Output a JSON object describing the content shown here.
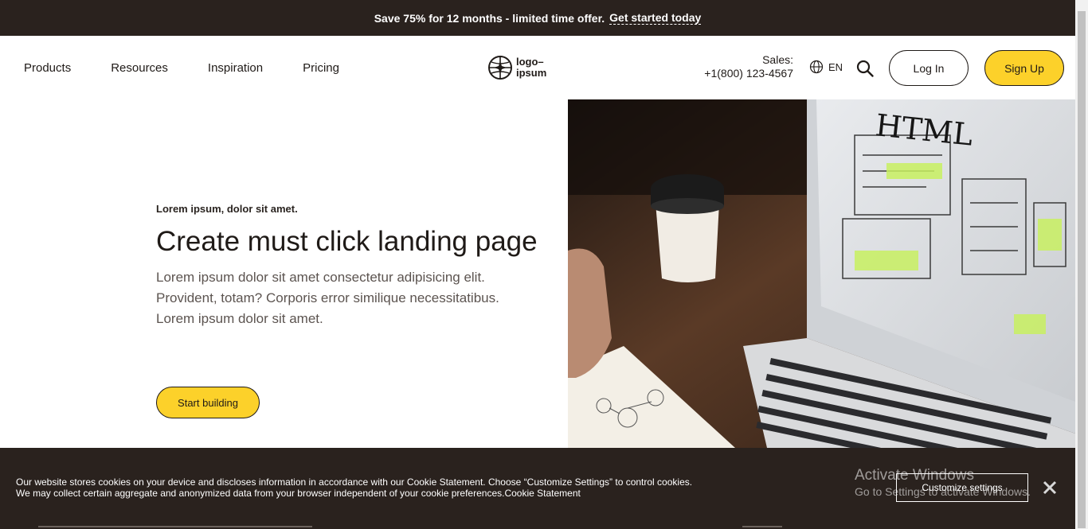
{
  "promo": {
    "text": "Save 75% for 12 months - limited time offer.",
    "link": "Get started today"
  },
  "nav": {
    "items": [
      {
        "label": "Products"
      },
      {
        "label": "Resources"
      },
      {
        "label": "Inspiration"
      },
      {
        "label": "Pricing"
      }
    ],
    "logo_line1": "logo–",
    "logo_line2": "ipsum",
    "sales_label": "Sales:",
    "sales_phone": "+1(800) 123-4567",
    "language": "EN",
    "login": "Log In",
    "signup": "Sign Up"
  },
  "hero": {
    "eyebrow": "Lorem ipsum, dolor sit amet.",
    "title": "Create must click landing page",
    "description": "Lorem ipsum dolor sit amet consectetur adipisicing elit. Provident, totam? Corporis error similique necessitatibus. Lorem ipsum dolor sit amet.",
    "cta": "Start building",
    "image_text": "HTML"
  },
  "cookie": {
    "line1": "Our website stores cookies on your device and discloses information in accordance with our Cookie Statement. Choose “Customize Settings” to control cookies.",
    "line2": "We may collect certain aggregate and anonymized data from your browser independent of your cookie preferences.Cookie Statement",
    "customize": "Customize settings"
  },
  "watermark": {
    "title": "Activate Windows",
    "subtitle": "Go to Settings to activate Windows."
  },
  "colors": {
    "dark": "#2a221e",
    "accent": "#fcd12a"
  }
}
